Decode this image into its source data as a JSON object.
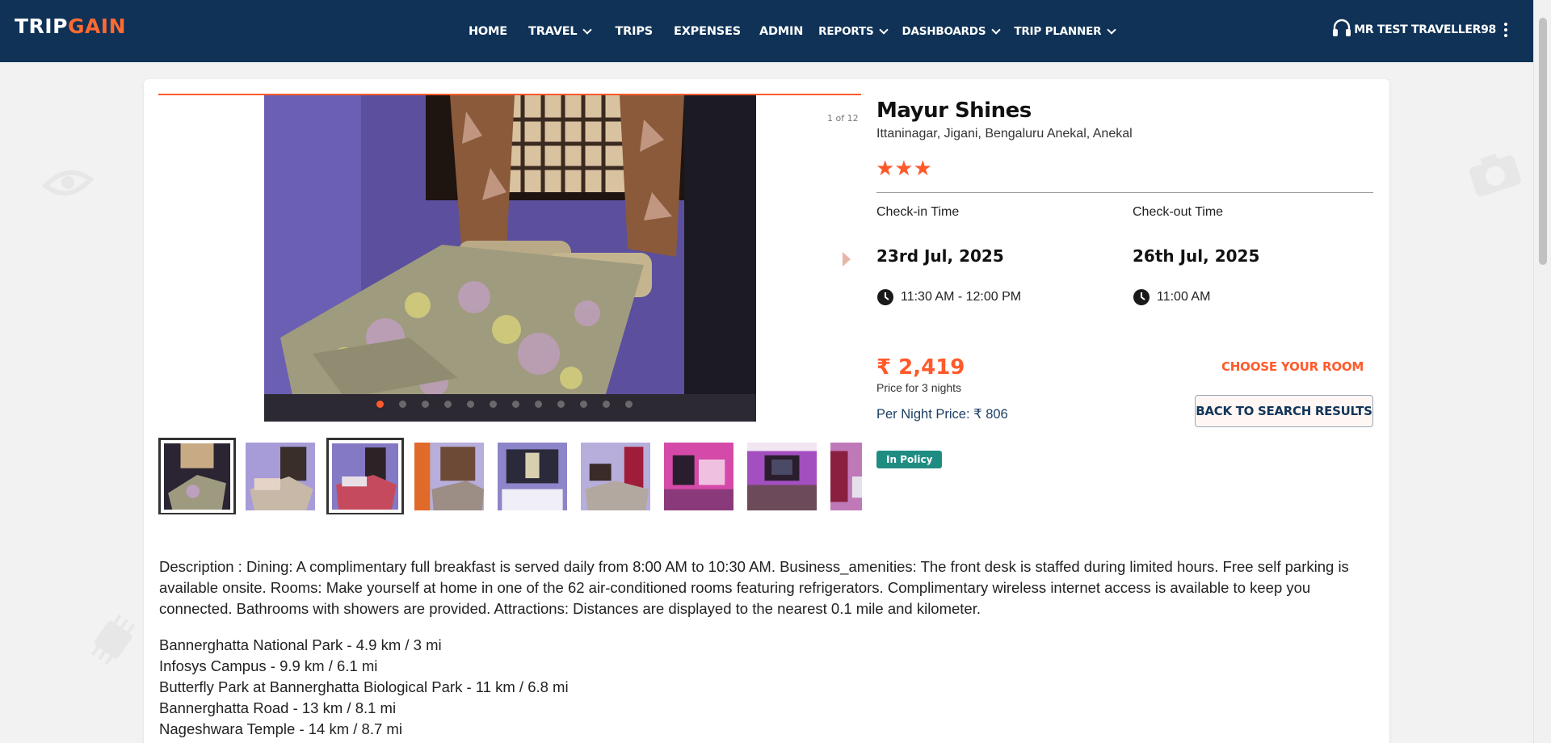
{
  "brand": {
    "logo_part1": "TRIP",
    "logo_part2": "GAIN"
  },
  "nav": {
    "items": [
      {
        "label": "HOME",
        "dropdown": false
      },
      {
        "label": "TRAVEL",
        "dropdown": true
      },
      {
        "label": "TRIPS",
        "dropdown": false
      },
      {
        "label": "EXPENSES",
        "dropdown": false
      },
      {
        "label": "ADMIN",
        "dropdown": false
      },
      {
        "label": "REPORTS",
        "dropdown": true
      },
      {
        "label": "DASHBOARDS",
        "dropdown": true
      },
      {
        "label": "TRIP PLANNER",
        "dropdown": true
      }
    ],
    "support_icon": "headset-icon",
    "user_name": "MR TEST TRAVELLER98",
    "user_menu_icon": "kebab-menu-icon"
  },
  "gallery": {
    "counter": "1 of 12",
    "total_images": 12,
    "active_index": 0,
    "thumbnails": 9
  },
  "hotel": {
    "name": "Mayur Shines",
    "address": "Ittaninagar, Jigani, Bengaluru Anekal, Anekal",
    "stars": 3,
    "star_glyphs": "★★★"
  },
  "stay": {
    "checkin_label": "Check-in Time",
    "checkout_label": "Check-out Time",
    "checkin_date": "23rd Jul, 2025",
    "checkout_date": "26th Jul, 2025",
    "checkin_time": "11:30 AM - 12:00 PM",
    "checkout_time": "11:00 AM"
  },
  "pricing": {
    "price": "₹ 2,419",
    "price_note": "Price for 3 nights",
    "per_night": "Per Night Price: ₹ 806",
    "choose_room_label": "CHOOSE YOUR ROOM",
    "back_label": "BACK TO SEARCH RESULTS",
    "policy_badge": "In Policy"
  },
  "colors": {
    "accent": "#ff5a2b",
    "header": "#0f3256",
    "policy": "#1f8c82"
  },
  "description": "Description : Dining: A complimentary full breakfast is served daily from 8:00 AM to 10:30 AM. Business_amenities: The front desk is staffed during limited hours. Free self parking is available onsite. Rooms: Make yourself at home in one of the 62 air-conditioned rooms featuring refrigerators. Complimentary wireless internet access is available to keep you connected. Bathrooms with showers are provided. Attractions: Distances are displayed to the nearest 0.1 mile and kilometer.",
  "attractions": [
    "Bannerghatta National Park - 4.9 km / 3 mi",
    "Infosys Campus - 9.9 km / 6.1 mi",
    "Butterfly Park at Bannerghatta Biological Park - 11 km / 6.8 mi",
    "Bannerghatta Road - 13 km / 8.1 mi",
    "Nageshwara Temple - 14 km / 8.7 mi"
  ]
}
